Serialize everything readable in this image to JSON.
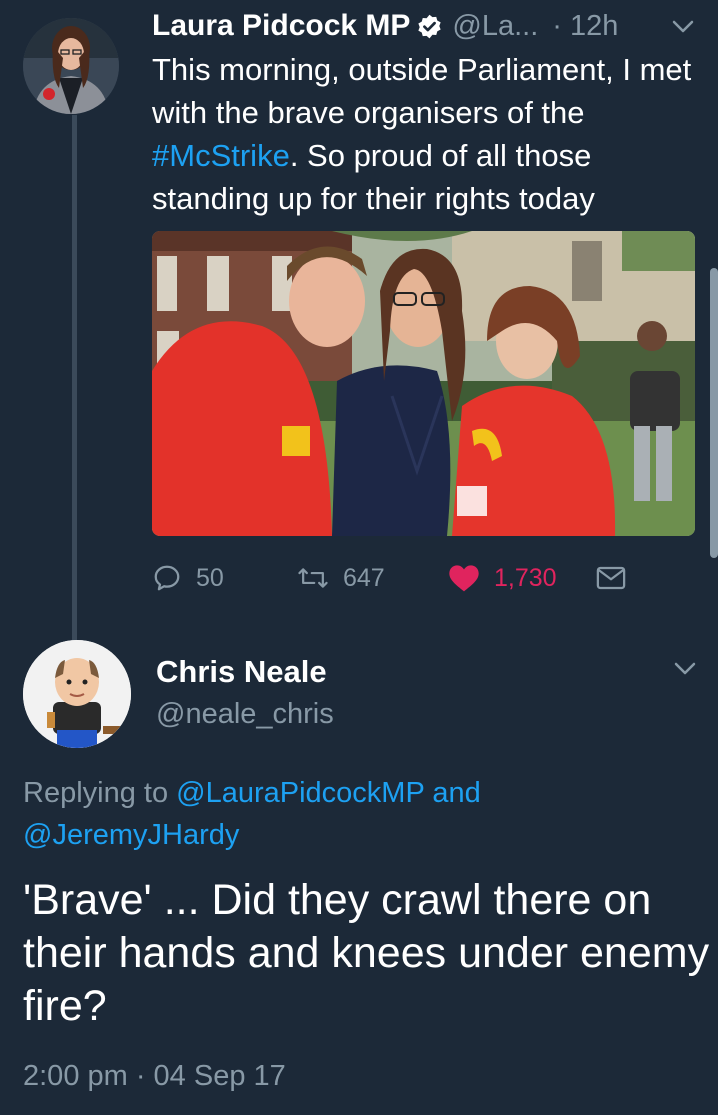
{
  "tweet1": {
    "name": "Laura Pidcock MP",
    "handle": "@La...",
    "time": "· 12h",
    "text_before": "This morning, outside Parliament, I met with the brave organisers of the ",
    "hashtag": "#McStrike",
    "text_after": ". So proud of all those standing up for their rights today",
    "replies": "50",
    "retweets": "647",
    "likes": "1,730",
    "photo": "photo"
  },
  "tweet2": {
    "name": "Chris Neale",
    "handle": "@neale_chris",
    "replying_prefix": "Replying to ",
    "mention1": "@LauraPidcockMP",
    "and": " and ",
    "mention2": "@JeremyJHardy",
    "text": "'Brave' ... Did they crawl there on their hands and knees under enemy fire?",
    "timestamp": "2:00 pm · 04 Sep 17"
  },
  "colors": {
    "background": "#1c2938",
    "accent": "#1da1f2",
    "secondary_text": "#8899a6",
    "like": "#e0245e"
  }
}
